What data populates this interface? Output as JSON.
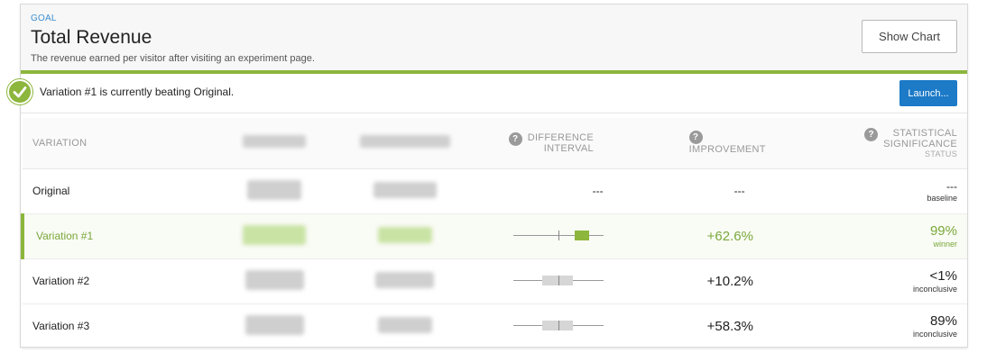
{
  "goal": {
    "label": "GOAL",
    "title": "Total Revenue",
    "description": "The revenue earned per visitor after visiting an experiment page.",
    "show_chart_label": "Show Chart"
  },
  "banner": {
    "message": "Variation #1 is currently beating Original.",
    "launch_label": "Launch..."
  },
  "table": {
    "headers": {
      "variation": "VARIATION",
      "difference_interval_line1": "DIFFERENCE",
      "difference_interval_line2": "INTERVAL",
      "improvement": "IMPROVEMENT",
      "significance_line1": "STATISTICAL",
      "significance_line2": "SIGNIFICANCE",
      "significance_sub": "STATUS"
    },
    "rows": [
      {
        "name": "Original",
        "improvement": "---",
        "significance": "---",
        "status": "baseline"
      },
      {
        "name": "Variation #1",
        "improvement": "+62.6%",
        "significance": "99%",
        "status": "winner"
      },
      {
        "name": "Variation #2",
        "improvement": "+10.2%",
        "significance": "<1%",
        "status": "inconclusive"
      },
      {
        "name": "Variation #3",
        "improvement": "+58.3%",
        "significance": "89%",
        "status": "inconclusive"
      }
    ],
    "original_interval": "---"
  },
  "colors": {
    "accent_green": "#8cb63c",
    "link_blue": "#3d8fd1",
    "button_blue": "#1c7ac7"
  }
}
